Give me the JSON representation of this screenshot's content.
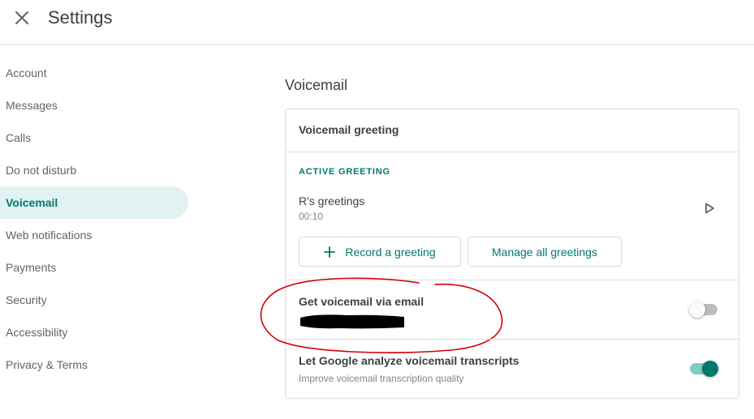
{
  "header": {
    "close_icon": "close-icon",
    "title": "Settings"
  },
  "sidebar": {
    "items": [
      {
        "label": "Account",
        "active": false
      },
      {
        "label": "Messages",
        "active": false
      },
      {
        "label": "Calls",
        "active": false
      },
      {
        "label": "Do not disturb",
        "active": false
      },
      {
        "label": "Voicemail",
        "active": true
      },
      {
        "label": "Web notifications",
        "active": false
      },
      {
        "label": "Payments",
        "active": false
      },
      {
        "label": "Security",
        "active": false
      },
      {
        "label": "Accessibility",
        "active": false
      },
      {
        "label": "Privacy & Terms",
        "active": false
      }
    ]
  },
  "voicemail": {
    "section_title": "Voicemail",
    "greeting_card": {
      "heading": "Voicemail greeting",
      "active_label": "ACTIVE GREETING",
      "greeting_name": "R's greetings",
      "greeting_duration": "00:10",
      "play_icon": "play-icon",
      "record_button": "Record a greeting",
      "record_icon": "plus-icon",
      "manage_button": "Manage all greetings"
    },
    "email_setting": {
      "heading": "Get voicemail via email",
      "enabled": false
    },
    "analyze_setting": {
      "heading": "Let Google analyze voicemail transcripts",
      "subtext": "Improve voicemail transcription quality",
      "enabled": true
    }
  },
  "colors": {
    "accent": "#00796b",
    "active_nav_bg": "#e0f2f1",
    "annotation": "#d50000",
    "divider": "#dadce0"
  }
}
